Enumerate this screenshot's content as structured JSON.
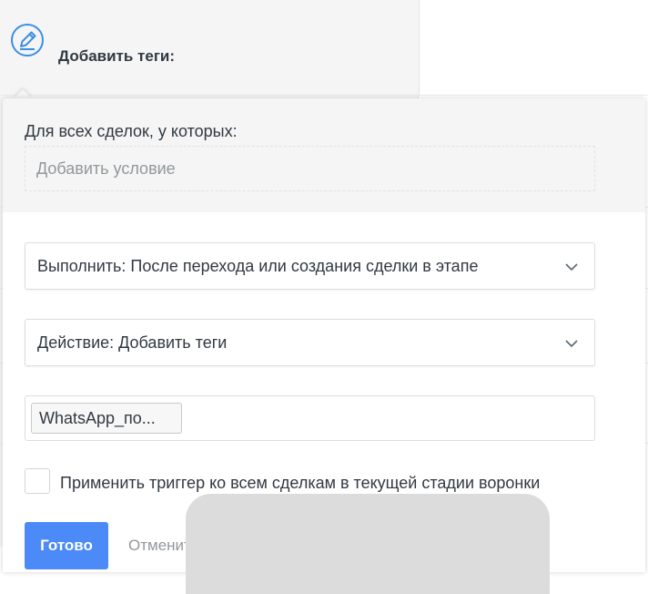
{
  "header": {
    "title": "Добавить теги:",
    "icon": "edit-icon"
  },
  "condition": {
    "label": "Для всех сделок, у которых:",
    "placeholder": "Добавить условие"
  },
  "execute_select": {
    "value": "Выполнить: После перехода или создания сделки в этапе"
  },
  "action_select": {
    "value": "Действие: Добавить теги"
  },
  "tags": [
    "WhatsApp_по..."
  ],
  "apply_all": {
    "label": "Применить триггер ко всем сделкам в текущей стадии воронки",
    "checked": false
  },
  "buttons": {
    "done": "Готово",
    "cancel": "Отменить"
  },
  "colors": {
    "accent": "#4c8bf7",
    "icon": "#3b8fe5",
    "panel_bg": "#f5f5f5"
  }
}
